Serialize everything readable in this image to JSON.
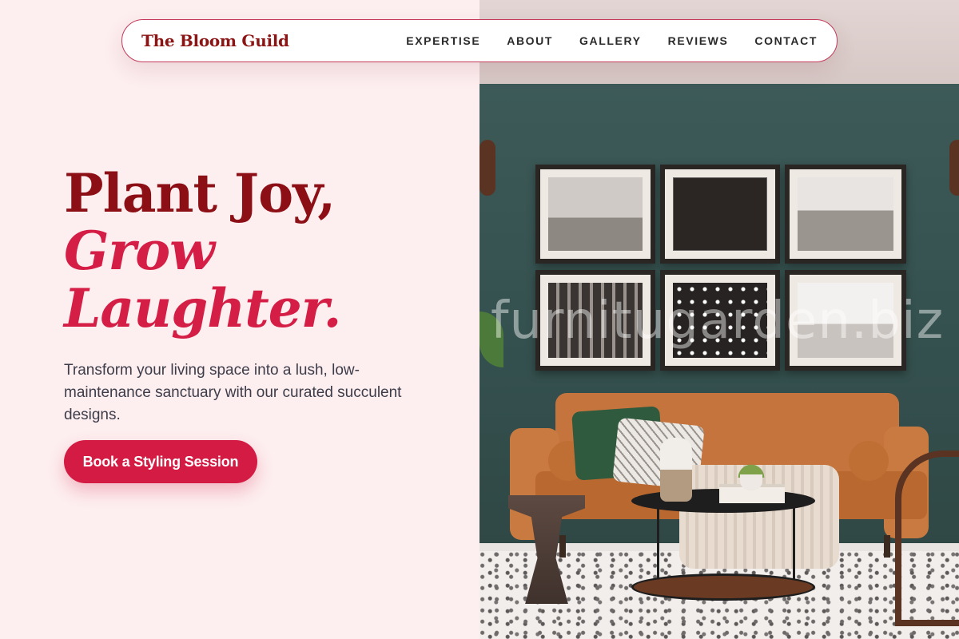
{
  "nav": {
    "brand": "The Bloom Guild",
    "links": [
      "EXPERTISE",
      "ABOUT",
      "GALLERY",
      "REVIEWS",
      "CONTACT"
    ]
  },
  "hero": {
    "title_line1": "Plant Joy,",
    "title_line2": "Grow",
    "title_line3": "Laughter.",
    "subtitle": "Transform your living space into a lush, low-maintenance sanctuary with our curated succulent designs.",
    "cta_label": "Book a Styling Session"
  },
  "image": {
    "watermark": "furnitugarden.biz"
  },
  "colors": {
    "brand_dark_red": "#8d0f16",
    "accent_crimson": "#d51e45",
    "button": "#d41b43",
    "left_background": "#fdeeef",
    "wall_teal": "#3d5a58"
  }
}
